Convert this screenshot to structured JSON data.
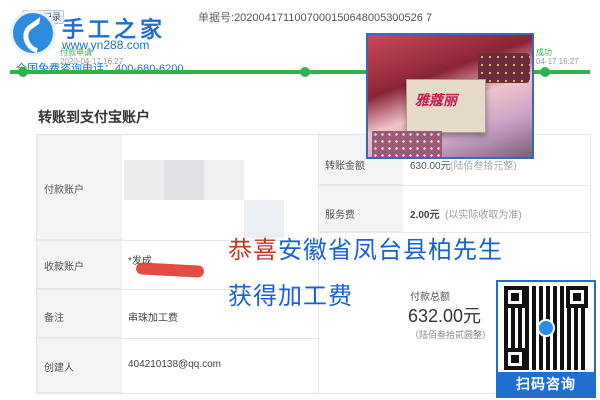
{
  "header": {
    "back_label": "返回记录",
    "order_label": "单据号:",
    "order_number": "2020041711007000150648005300526 7",
    "logo_title": "手工之家",
    "logo_url": "www.yn288.com",
    "hotline": "全国免费咨询电话：400-680-6200"
  },
  "progress": {
    "steps": [
      {
        "label": "付款申请",
        "time": "2020-04-17 16:27"
      },
      {
        "label": "成功",
        "time": "04-17 16:27"
      }
    ]
  },
  "transfer": {
    "section_title": "转账到支付宝账户",
    "rows_left": [
      {
        "label": "付款账户",
        "value": ""
      },
      {
        "label": "收款账户",
        "value": "*发成"
      },
      {
        "label": "备注",
        "value": "串珠加工费"
      },
      {
        "label": "创建人",
        "value": "404210138@qq.com"
      }
    ],
    "rows_right": [
      {
        "label": "转账金额",
        "value": "630.00元",
        "note": "(陆佰叁拾元整)"
      },
      {
        "label": "服务费",
        "value": "2.00元",
        "note": "(以实际收取为准)"
      }
    ],
    "total_label": "付款总额",
    "total_value": "632.00元",
    "total_words": "（陆佰叁拾贰圆整）"
  },
  "overlay": {
    "prefix": "恭喜",
    "line1": "安徽省凤台县柏先生",
    "line2": "获得加工费"
  },
  "promo": {
    "photo_brand": "雅蔻丽",
    "qr_label": "扫码咨询"
  },
  "colors": {
    "brand_blue": "#1e6fcf",
    "progress_green": "#2fb34a",
    "overlay_blue": "#1860d8"
  }
}
